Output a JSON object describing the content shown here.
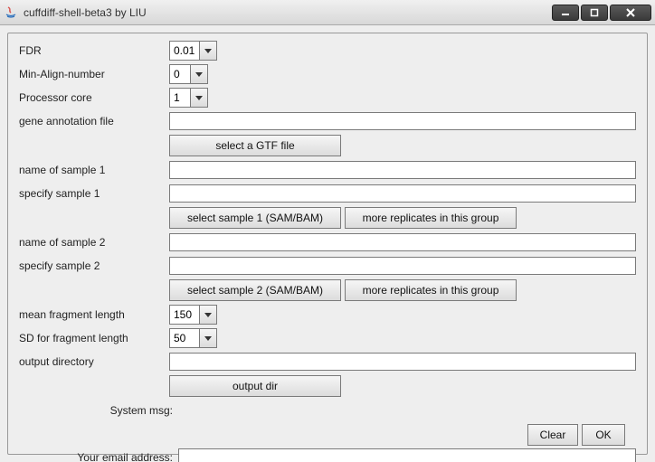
{
  "window": {
    "title": "cuffdiff-shell-beta3 by LIU"
  },
  "labels": {
    "fdr": "FDR",
    "min_align": "Min-Align-number",
    "cores": "Processor core",
    "gene_annot": "gene annotation file",
    "name_s1": "name of sample 1",
    "spec_s1": "specify sample 1",
    "name_s2": "name of sample 2",
    "spec_s2": "specify sample 2",
    "mean_frag": "mean fragment length",
    "sd_frag": "SD for fragment length",
    "out_dir": "output directory",
    "sys_msg": "System msg:",
    "email": "Your email address:"
  },
  "values": {
    "fdr": "0.01",
    "min_align": "0",
    "cores": "1",
    "gene_annot": "",
    "name_s1": "",
    "spec_s1": "",
    "name_s2": "",
    "spec_s2": "",
    "mean_frag": "150",
    "sd_frag": "50",
    "out_dir": "",
    "email": ""
  },
  "buttons": {
    "select_gtf": "select a GTF file",
    "select_s1": "select sample 1 (SAM/BAM)",
    "more_rep1": "more replicates in this group",
    "select_s2": "select sample 2 (SAM/BAM)",
    "more_rep2": "more replicates in this group",
    "output_dir": "output dir",
    "clear": "Clear",
    "ok": "OK"
  }
}
